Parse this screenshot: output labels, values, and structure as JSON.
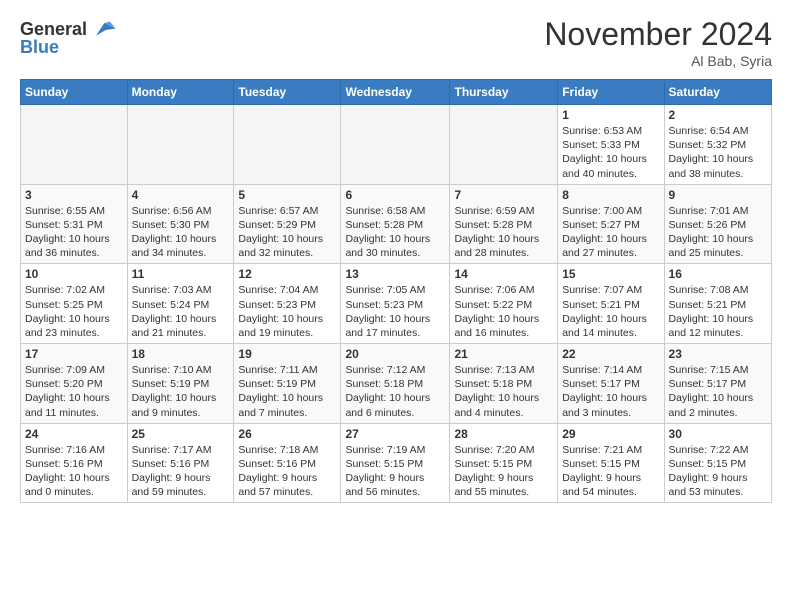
{
  "header": {
    "logo_line1": "General",
    "logo_line2": "Blue",
    "month": "November 2024",
    "location": "Al Bab, Syria"
  },
  "weekdays": [
    "Sunday",
    "Monday",
    "Tuesday",
    "Wednesday",
    "Thursday",
    "Friday",
    "Saturday"
  ],
  "weeks": [
    [
      {
        "day": "",
        "info": ""
      },
      {
        "day": "",
        "info": ""
      },
      {
        "day": "",
        "info": ""
      },
      {
        "day": "",
        "info": ""
      },
      {
        "day": "",
        "info": ""
      },
      {
        "day": "1",
        "info": "Sunrise: 6:53 AM\nSunset: 5:33 PM\nDaylight: 10 hours\nand 40 minutes."
      },
      {
        "day": "2",
        "info": "Sunrise: 6:54 AM\nSunset: 5:32 PM\nDaylight: 10 hours\nand 38 minutes."
      }
    ],
    [
      {
        "day": "3",
        "info": "Sunrise: 6:55 AM\nSunset: 5:31 PM\nDaylight: 10 hours\nand 36 minutes."
      },
      {
        "day": "4",
        "info": "Sunrise: 6:56 AM\nSunset: 5:30 PM\nDaylight: 10 hours\nand 34 minutes."
      },
      {
        "day": "5",
        "info": "Sunrise: 6:57 AM\nSunset: 5:29 PM\nDaylight: 10 hours\nand 32 minutes."
      },
      {
        "day": "6",
        "info": "Sunrise: 6:58 AM\nSunset: 5:28 PM\nDaylight: 10 hours\nand 30 minutes."
      },
      {
        "day": "7",
        "info": "Sunrise: 6:59 AM\nSunset: 5:28 PM\nDaylight: 10 hours\nand 28 minutes."
      },
      {
        "day": "8",
        "info": "Sunrise: 7:00 AM\nSunset: 5:27 PM\nDaylight: 10 hours\nand 27 minutes."
      },
      {
        "day": "9",
        "info": "Sunrise: 7:01 AM\nSunset: 5:26 PM\nDaylight: 10 hours\nand 25 minutes."
      }
    ],
    [
      {
        "day": "10",
        "info": "Sunrise: 7:02 AM\nSunset: 5:25 PM\nDaylight: 10 hours\nand 23 minutes."
      },
      {
        "day": "11",
        "info": "Sunrise: 7:03 AM\nSunset: 5:24 PM\nDaylight: 10 hours\nand 21 minutes."
      },
      {
        "day": "12",
        "info": "Sunrise: 7:04 AM\nSunset: 5:23 PM\nDaylight: 10 hours\nand 19 minutes."
      },
      {
        "day": "13",
        "info": "Sunrise: 7:05 AM\nSunset: 5:23 PM\nDaylight: 10 hours\nand 17 minutes."
      },
      {
        "day": "14",
        "info": "Sunrise: 7:06 AM\nSunset: 5:22 PM\nDaylight: 10 hours\nand 16 minutes."
      },
      {
        "day": "15",
        "info": "Sunrise: 7:07 AM\nSunset: 5:21 PM\nDaylight: 10 hours\nand 14 minutes."
      },
      {
        "day": "16",
        "info": "Sunrise: 7:08 AM\nSunset: 5:21 PM\nDaylight: 10 hours\nand 12 minutes."
      }
    ],
    [
      {
        "day": "17",
        "info": "Sunrise: 7:09 AM\nSunset: 5:20 PM\nDaylight: 10 hours\nand 11 minutes."
      },
      {
        "day": "18",
        "info": "Sunrise: 7:10 AM\nSunset: 5:19 PM\nDaylight: 10 hours\nand 9 minutes."
      },
      {
        "day": "19",
        "info": "Sunrise: 7:11 AM\nSunset: 5:19 PM\nDaylight: 10 hours\nand 7 minutes."
      },
      {
        "day": "20",
        "info": "Sunrise: 7:12 AM\nSunset: 5:18 PM\nDaylight: 10 hours\nand 6 minutes."
      },
      {
        "day": "21",
        "info": "Sunrise: 7:13 AM\nSunset: 5:18 PM\nDaylight: 10 hours\nand 4 minutes."
      },
      {
        "day": "22",
        "info": "Sunrise: 7:14 AM\nSunset: 5:17 PM\nDaylight: 10 hours\nand 3 minutes."
      },
      {
        "day": "23",
        "info": "Sunrise: 7:15 AM\nSunset: 5:17 PM\nDaylight: 10 hours\nand 2 minutes."
      }
    ],
    [
      {
        "day": "24",
        "info": "Sunrise: 7:16 AM\nSunset: 5:16 PM\nDaylight: 10 hours\nand 0 minutes."
      },
      {
        "day": "25",
        "info": "Sunrise: 7:17 AM\nSunset: 5:16 PM\nDaylight: 9 hours\nand 59 minutes."
      },
      {
        "day": "26",
        "info": "Sunrise: 7:18 AM\nSunset: 5:16 PM\nDaylight: 9 hours\nand 57 minutes."
      },
      {
        "day": "27",
        "info": "Sunrise: 7:19 AM\nSunset: 5:15 PM\nDaylight: 9 hours\nand 56 minutes."
      },
      {
        "day": "28",
        "info": "Sunrise: 7:20 AM\nSunset: 5:15 PM\nDaylight: 9 hours\nand 55 minutes."
      },
      {
        "day": "29",
        "info": "Sunrise: 7:21 AM\nSunset: 5:15 PM\nDaylight: 9 hours\nand 54 minutes."
      },
      {
        "day": "30",
        "info": "Sunrise: 7:22 AM\nSunset: 5:15 PM\nDaylight: 9 hours\nand 53 minutes."
      }
    ]
  ]
}
